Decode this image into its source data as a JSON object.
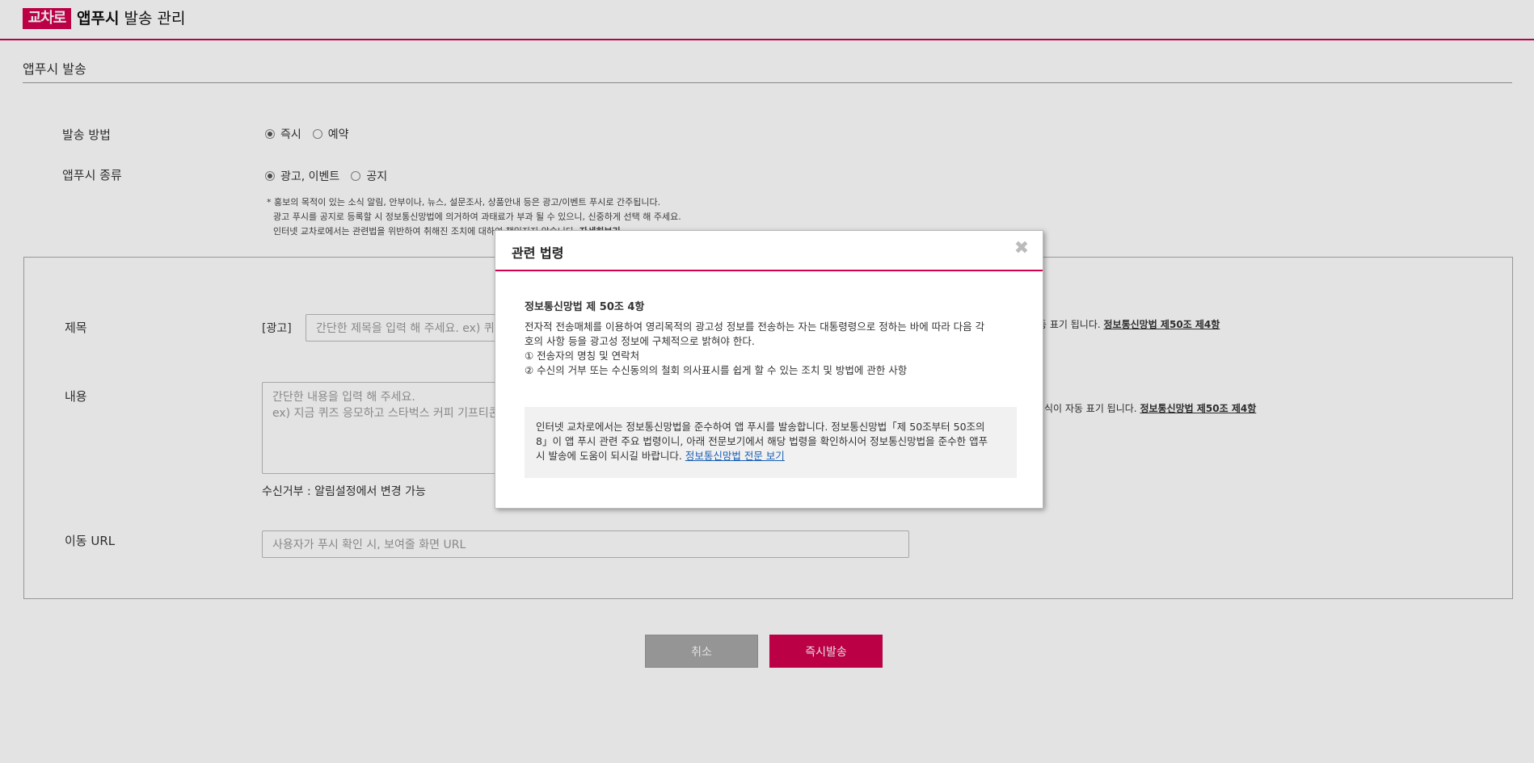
{
  "header": {
    "logo_text": "교차로",
    "app_title_bold": "앱푸시",
    "app_title_rest": " 발송 관리"
  },
  "section": {
    "title": "앱푸시 발송"
  },
  "form": {
    "send_method": {
      "label": "발송 방법",
      "options": [
        {
          "label": "즉시",
          "selected": true
        },
        {
          "label": "예약",
          "selected": false
        }
      ]
    },
    "push_type": {
      "label": "앱푸시 종류",
      "options": [
        {
          "label": "광고, 이벤트",
          "selected": true
        },
        {
          "label": "공지",
          "selected": false
        }
      ]
    },
    "notice_lines": [
      "* 홍보의 목적이 있는 소식 알림, 안부이나, 뉴스, 설문조사, 상품안내 등은 광고/이벤트 푸시로 간주됩니다.",
      "광고 푸시를 공지로 등록할 시 정보통신망법에 의거하여 과태료가 부과 될 수 있으니, 신중하게 선택 해 주세요.",
      "인터넷 교차로에서는 관련법을 위반하여 취해진 조치에 대하여 책임지지 않습니다."
    ],
    "notice_detail_link": "자세히보기",
    "title_field": {
      "label": "제목",
      "ad_tag": "[광고]",
      "placeholder": "간단한 제목을 입력 해 주세요. ex) 퀴즈",
      "side_note": "동 표기 됩니다.",
      "side_link": "정보통신망법 제50조 제4항"
    },
    "content_field": {
      "label": "내용",
      "placeholder_line1": "간단한 내용을 입력 해 주세요.",
      "placeholder_line2": "ex) 지금 퀴즈 응모하고 스타벅스 커피 기프티콘",
      "side_note": "식이 자동 표기 됩니다.",
      "side_link": "정보통신망법 제50조 제4항",
      "optout": "수신거부 : 알림설정에서 변경 가능"
    },
    "url_field": {
      "label": "이동 URL",
      "placeholder": "사용자가 푸시 확인 시, 보여줄 화면 URL"
    }
  },
  "buttons": {
    "cancel": "취소",
    "send": "즉시발송"
  },
  "modal": {
    "title": "관련 법령",
    "close_glyph": "✖",
    "law_title": "정보통신망법 제 50조 4항",
    "law_lines": [
      "전자적 전송매체를 이용하여 영리목적의 광고성 정보를 전송하는 자는 대통령령으로 정하는 바에 따라 다음 각",
      "호의 사항 등을 광고성 정보에 구체적으로 밝혀야 한다.",
      "① 전송자의 명칭 및 연락처",
      "② 수신의 거부 또는 수신동의의 철회 의사표시를 쉽게 할 수 있는 조치 및 방법에 관한 사항"
    ],
    "info_lines": [
      "인터넷 교차로에서는 정보통신망법을 준수하여 앱 푸시를 발송합니다. 정보통신망법「제 50조부터 50조의",
      "8」이 앱 푸시 관련 주요 법령이니, 아래 전문보기에서 해당 법령을 확인하시어 정보통신망법을 준수한 앱푸",
      "시 발송에 도움이 되시길 바랍니다. "
    ],
    "info_link": "정보통신망법 전문 보기"
  },
  "colors": {
    "accent": "#d2004f",
    "link": "#1a5fb4"
  }
}
